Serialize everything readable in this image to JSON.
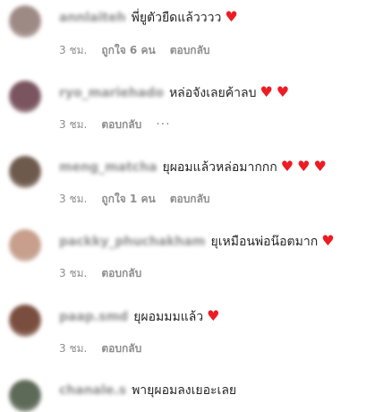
{
  "comments": [
    {
      "username": "annlaiteh",
      "text": "พี่ยูตัวยืดแล้วววว",
      "hearts": [
        "♥"
      ],
      "time": "3 ชม.",
      "likes": "ถูกใจ 6 คน",
      "reply": "ตอบกลับ",
      "more": "",
      "avatar_color": "#9e8a84"
    },
    {
      "username": "ryo_mariehado",
      "text": "หล่อจังเลยค้าลบ",
      "hearts": [
        "♥",
        "♥"
      ],
      "time": "3 ชม.",
      "likes": "",
      "reply": "ตอบกลับ",
      "more": "···",
      "avatar_color": "#7a5560"
    },
    {
      "username": "meng_matcha",
      "text": "ยุผอมแล้วหล่อมากกก",
      "hearts": [
        "♥",
        "♥",
        "♥"
      ],
      "time": "3 ชม.",
      "likes": "ถูกใจ 1 คน",
      "reply": "ตอบกลับ",
      "more": "",
      "avatar_color": "#6e5a4c"
    },
    {
      "username": "packky_phuchakham",
      "text": "ยุเหมือนพ่อน๊อตมาก",
      "hearts": [
        "♥"
      ],
      "time": "3 ชม.",
      "likes": "",
      "reply": "ตอบกลับ",
      "more": "",
      "avatar_color": "#c79f8c"
    },
    {
      "username": "paap.smd",
      "text": "ยุผอมมมแล้ว",
      "hearts": [
        "♥"
      ],
      "time": "3 ชม.",
      "likes": "",
      "reply": "ตอบกลับ",
      "more": "",
      "avatar_color": "#7a4e3e"
    },
    {
      "username": "chanale.s",
      "text": "พายุผอมลงเยอะเลย",
      "hearts": [],
      "time": "",
      "likes": "",
      "reply": "",
      "more": "",
      "avatar_color": "#5e6a58"
    }
  ]
}
